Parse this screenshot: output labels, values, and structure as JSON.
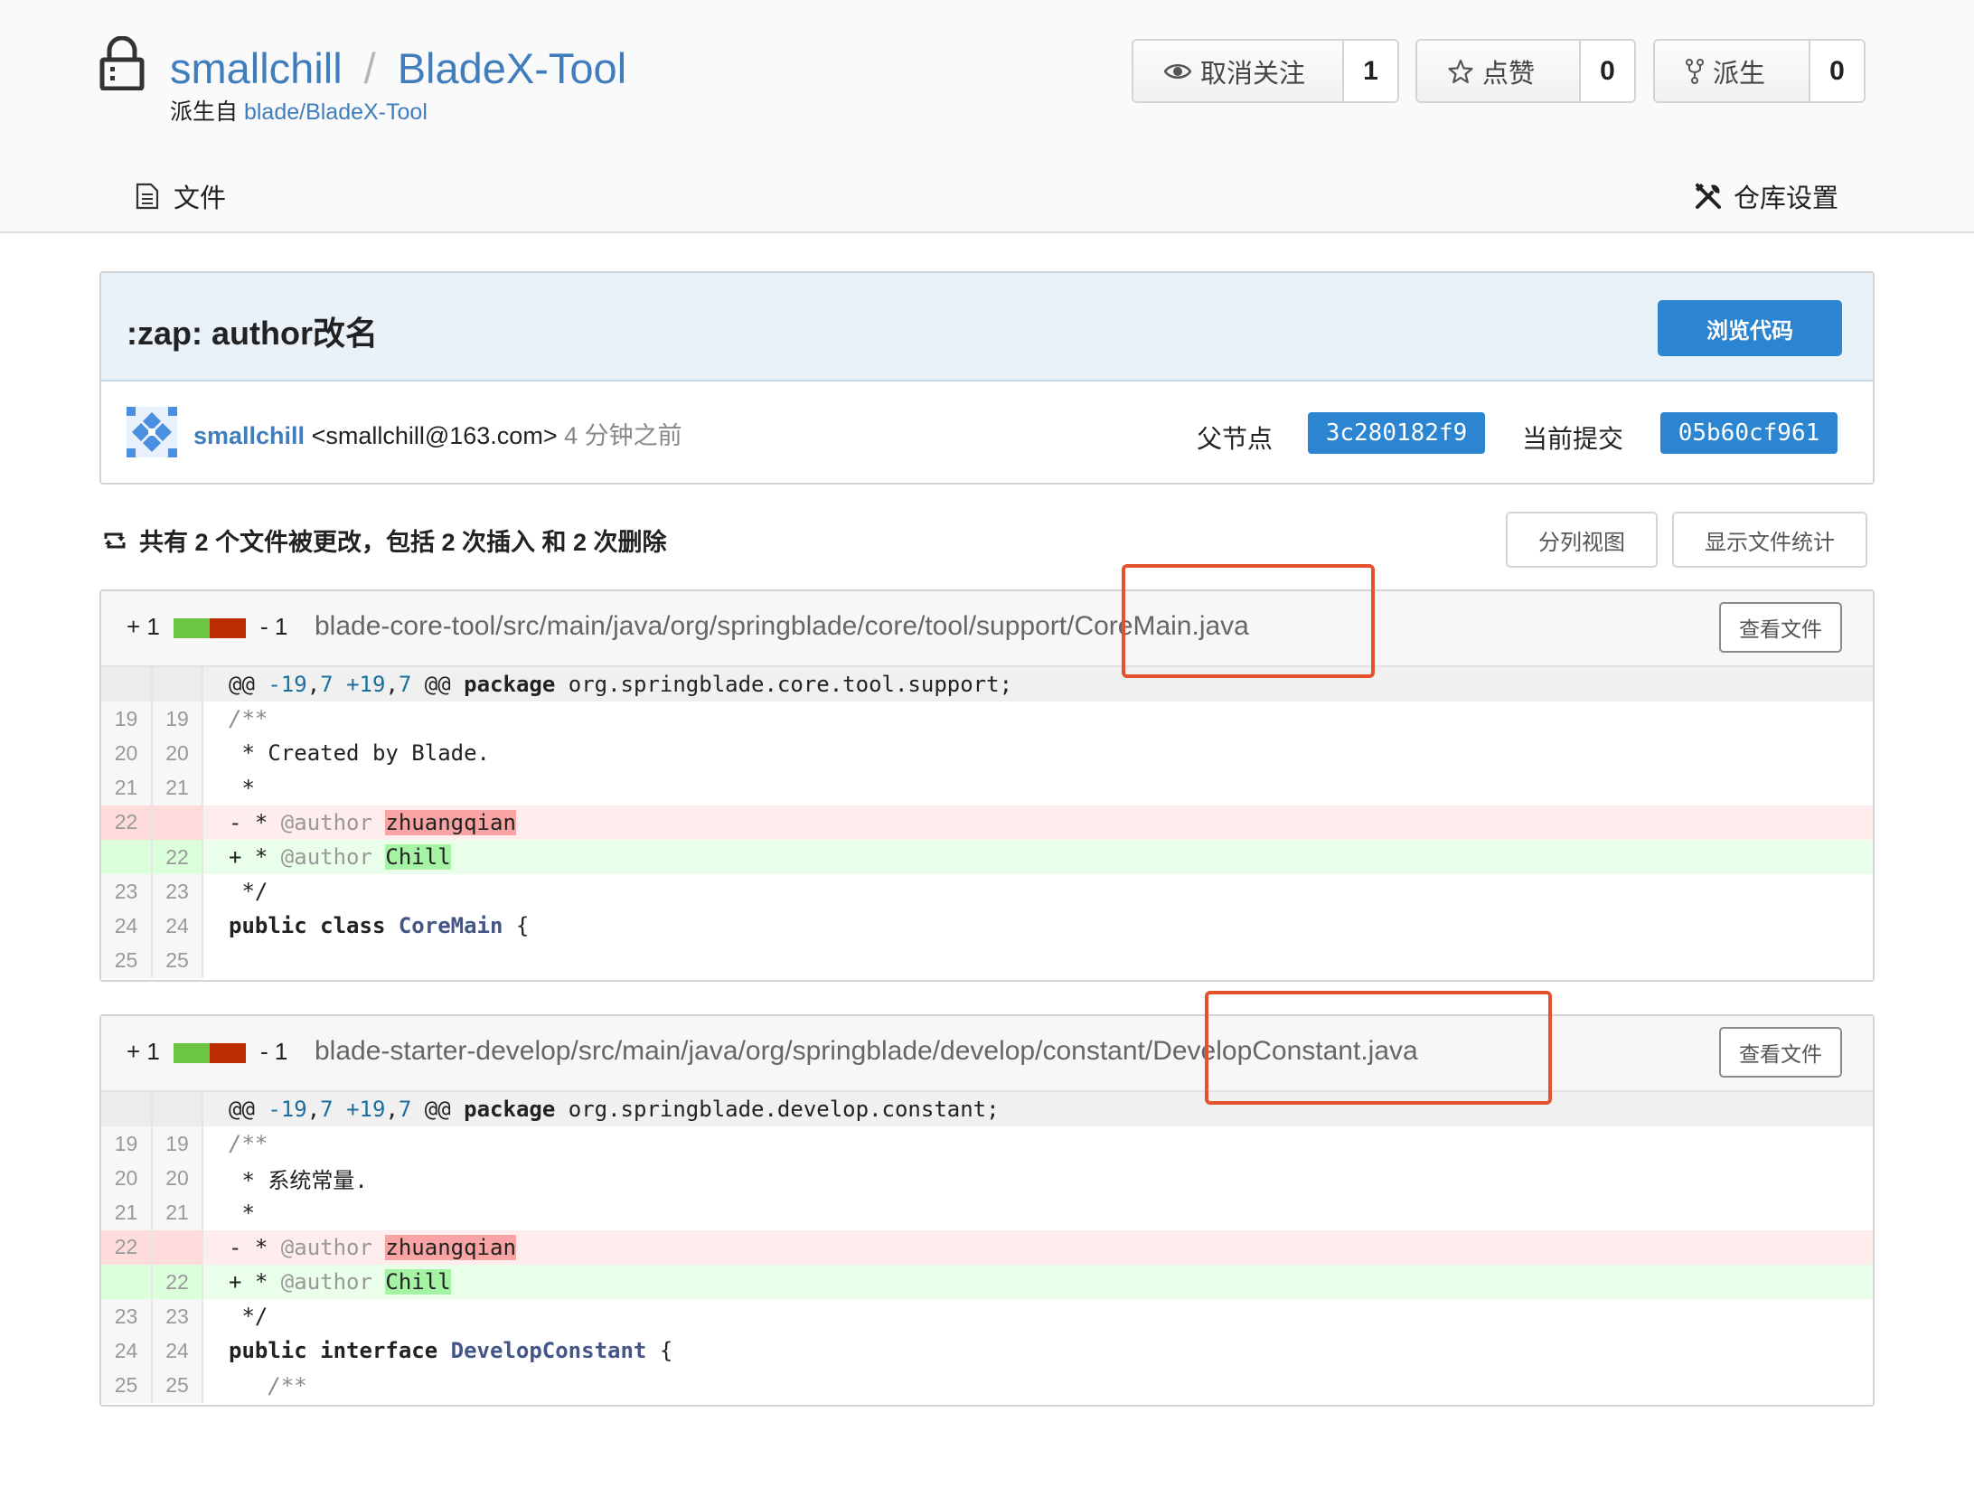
{
  "repo": {
    "owner": "smallchill",
    "separator": "/",
    "name": "BladeX-Tool",
    "fork_prefix": "派生自 ",
    "fork_source": "blade/BladeX-Tool"
  },
  "actions": {
    "watch": {
      "label": "取消关注",
      "count": "1",
      "icon": "eye-icon"
    },
    "star": {
      "label": "点赞",
      "count": "0",
      "icon": "star-icon"
    },
    "fork": {
      "label": "派生",
      "count": "0",
      "icon": "fork-icon"
    }
  },
  "nav": {
    "files": "文件",
    "settings": "仓库设置"
  },
  "commit": {
    "message": ":zap: author改名",
    "browse_button": "浏览代码",
    "author": "smallchill",
    "email": " <smallchill@163.com> ",
    "time_ago": "4 分钟之前",
    "parent_label": "父节点",
    "parent_sha": "3c280182f9",
    "current_label": "当前提交",
    "current_sha": "05b60cf961"
  },
  "summary": {
    "text": "共有 2 个文件被更改，包括 2 次插入 和 2 次删除",
    "split_view": "分列视图",
    "show_stats": "显示文件统计"
  },
  "files": [
    {
      "additions": "+ 1",
      "deletions": "- 1",
      "path": "blade-core-tool/src/main/java/org/springblade/core/tool/support/CoreMain.java",
      "view_button": "查看文件",
      "hunk_header": "@@ -19,7 +19,7 @@ package org.springblade.core.tool.support;",
      "lines": [
        {
          "old": "19",
          "new": "19",
          "type": "ctx",
          "text": "/**"
        },
        {
          "old": "20",
          "new": "20",
          "type": "ctx",
          "text": " * Created by Blade."
        },
        {
          "old": "21",
          "new": "21",
          "type": "ctx",
          "text": " *"
        },
        {
          "old": "22",
          "new": "",
          "type": "del",
          "text": "- * @author zhuangqian"
        },
        {
          "old": "",
          "new": "22",
          "type": "add",
          "text": "+ * @author Chill"
        },
        {
          "old": "23",
          "new": "23",
          "type": "ctx",
          "text": " */"
        },
        {
          "old": "24",
          "new": "24",
          "type": "ctx",
          "text": "public class CoreMain {"
        },
        {
          "old": "25",
          "new": "25",
          "type": "ctx",
          "text": ""
        }
      ]
    },
    {
      "additions": "+ 1",
      "deletions": "- 1",
      "path": "blade-starter-develop/src/main/java/org/springblade/develop/constant/DevelopConstant.java",
      "view_button": "查看文件",
      "hunk_header": "@@ -19,7 +19,7 @@ package org.springblade.develop.constant;",
      "lines": [
        {
          "old": "19",
          "new": "19",
          "type": "ctx",
          "text": "/**"
        },
        {
          "old": "20",
          "new": "20",
          "type": "ctx",
          "text": " * 系统常量."
        },
        {
          "old": "21",
          "new": "21",
          "type": "ctx",
          "text": " *"
        },
        {
          "old": "22",
          "new": "",
          "type": "del",
          "text": "- * @author zhuangqian"
        },
        {
          "old": "",
          "new": "22",
          "type": "add",
          "text": "+ * @author Chill"
        },
        {
          "old": "23",
          "new": "23",
          "type": "ctx",
          "text": " */"
        },
        {
          "old": "24",
          "new": "24",
          "type": "ctx",
          "text": "public interface DevelopConstant {"
        },
        {
          "old": "25",
          "new": "25",
          "type": "ctx",
          "text": "   /**"
        }
      ]
    }
  ],
  "colors": {
    "link": "#3f7dbd",
    "primary_button": "#2c85d0",
    "deleted_bg": "#ffecec",
    "added_bg": "#eaffea",
    "annotation_box": "#e4512d"
  }
}
